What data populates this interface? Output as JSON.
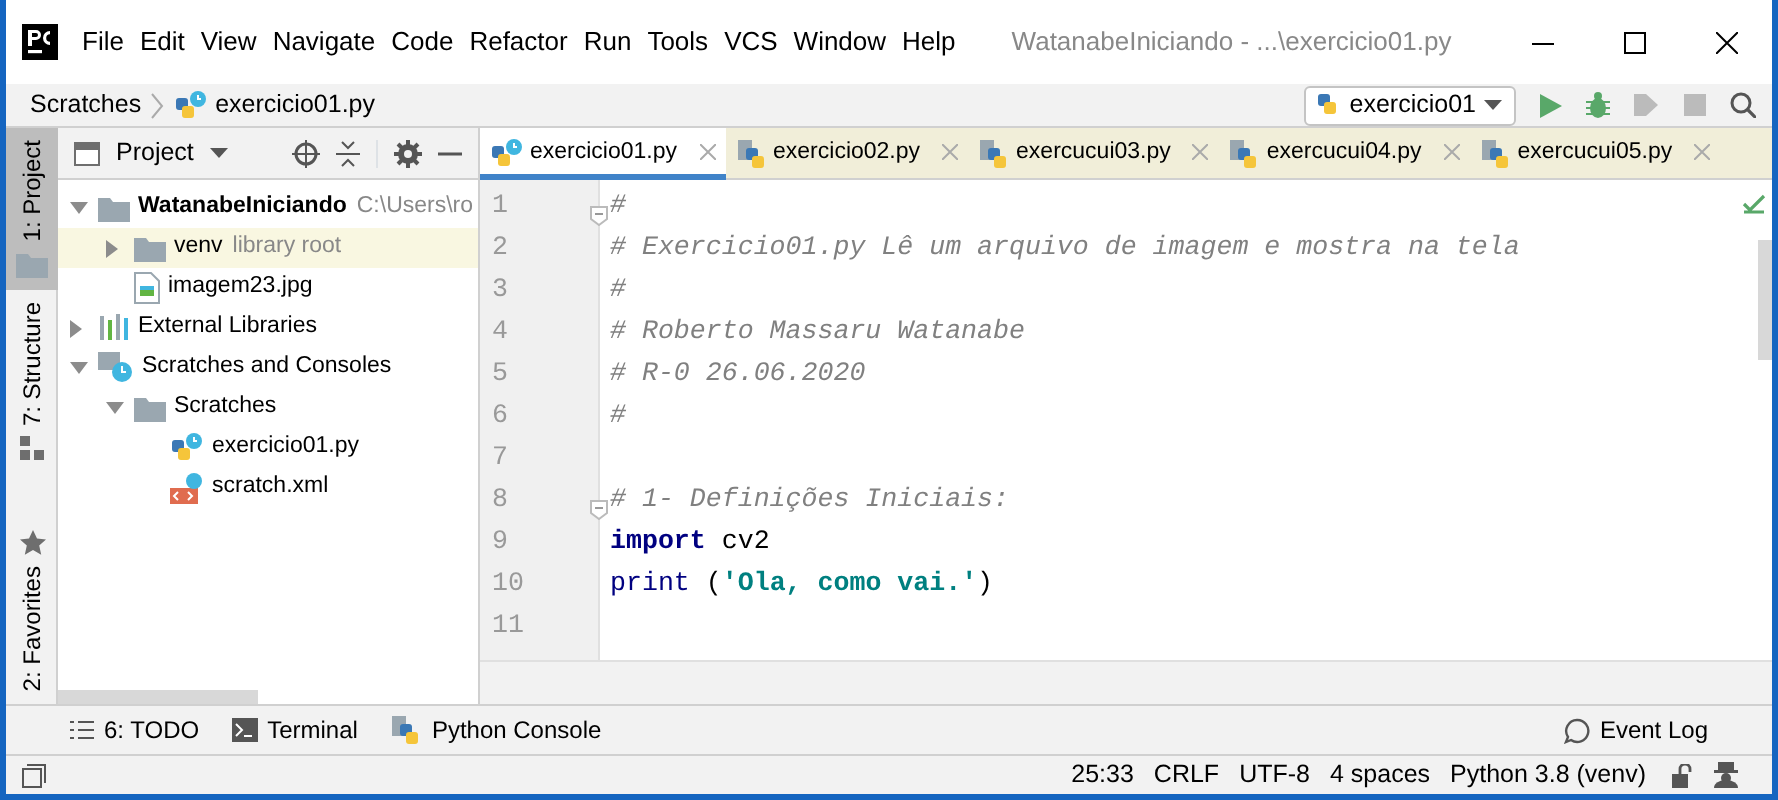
{
  "window": {
    "title": "WatanabeIniciando - ...\\exercicio01.py"
  },
  "menu": [
    "File",
    "Edit",
    "View",
    "Navigate",
    "Code",
    "Refactor",
    "Run",
    "Tools",
    "VCS",
    "Window",
    "Help"
  ],
  "breadcrumbs": [
    {
      "label": "Scratches"
    },
    {
      "label": "exercicio01.py",
      "kind": "python-scratch"
    }
  ],
  "run_configuration": {
    "label": "exercicio01"
  },
  "left_stripe": [
    {
      "label": "1: Project",
      "kind": "folder",
      "selected": true
    },
    {
      "label": "7: Structure",
      "kind": "structure",
      "selected": false
    },
    {
      "label": "2: Favorites",
      "kind": "star",
      "selected": false
    }
  ],
  "project_panel": {
    "title": "Project",
    "tree": [
      {
        "label": "WatanabeIniciando",
        "hint": "C:\\Users\\ro",
        "kind": "folder",
        "bold": true,
        "expanded": true,
        "highlighted": false,
        "children": [
          {
            "label": "venv",
            "hint": "library root",
            "kind": "folder",
            "bold": false,
            "expanded": false,
            "highlighted": true
          },
          {
            "label": "imagem23.jpg",
            "kind": "image",
            "bold": false,
            "highlighted": false
          }
        ]
      },
      {
        "label": "External Libraries",
        "kind": "libraries",
        "bold": false,
        "expanded": false,
        "highlighted": false
      },
      {
        "label": "Scratches and Consoles",
        "kind": "scratches",
        "bold": false,
        "expanded": true,
        "highlighted": false,
        "children": [
          {
            "label": "Scratches",
            "kind": "folder",
            "bold": false,
            "expanded": true,
            "highlighted": false,
            "children": [
              {
                "label": "exercicio01.py",
                "kind": "python-scratch",
                "bold": false,
                "highlighted": false
              },
              {
                "label": "scratch.xml",
                "kind": "xml-scratch",
                "bold": false,
                "highlighted": false
              }
            ]
          }
        ]
      }
    ]
  },
  "editor_tabs": [
    {
      "label": "exercicio01.py",
      "kind": "python-scratch",
      "selected": true
    },
    {
      "label": "exercicio02.py",
      "kind": "python",
      "selected": false
    },
    {
      "label": "exercucui03.py",
      "kind": "python",
      "selected": false
    },
    {
      "label": "exercucui04.py",
      "kind": "python",
      "selected": false
    },
    {
      "label": "exercucui05.py",
      "kind": "python",
      "selected": false
    }
  ],
  "code": [
    {
      "number": "1",
      "fold": true,
      "tokens": [
        {
          "kind": "comment",
          "text": "#"
        }
      ]
    },
    {
      "number": "2",
      "fold": false,
      "tokens": [
        {
          "kind": "comment",
          "text": "# Exercicio01.py Lê um arquivo de imagem e mostra na tela"
        }
      ]
    },
    {
      "number": "3",
      "fold": false,
      "tokens": [
        {
          "kind": "comment",
          "text": "#"
        }
      ]
    },
    {
      "number": "4",
      "fold": false,
      "tokens": [
        {
          "kind": "comment",
          "text": "# Roberto Massaru Watanabe"
        }
      ]
    },
    {
      "number": "5",
      "fold": false,
      "tokens": [
        {
          "kind": "comment",
          "text": "# R-0 26.06.2020"
        }
      ]
    },
    {
      "number": "6",
      "fold": false,
      "tokens": [
        {
          "kind": "comment",
          "text": "#"
        }
      ]
    },
    {
      "number": "7",
      "fold": false
    },
    {
      "number": "8",
      "fold": true,
      "tokens": [
        {
          "kind": "comment",
          "text": "# 1- Definições Iniciais:"
        }
      ]
    },
    {
      "number": "9",
      "fold": false,
      "tokens": [
        {
          "kind": "keyword",
          "text": "import"
        },
        {
          "kind": "plain",
          "text": " cv2"
        }
      ]
    },
    {
      "number": "10",
      "fold": false,
      "tokens": [
        {
          "kind": "builtin",
          "text": "print"
        },
        {
          "kind": "plain",
          "text": " ("
        },
        {
          "kind": "string",
          "text": "'Ola, como vai.'"
        },
        {
          "kind": "plain",
          "text": ")"
        }
      ]
    },
    {
      "number": "11",
      "fold": false
    }
  ],
  "tool_buttons": [
    {
      "label": "6: TODO",
      "kind": "todo"
    },
    {
      "label": "Terminal",
      "kind": "terminal"
    },
    {
      "label": "Python Console",
      "kind": "python"
    }
  ],
  "event_log": {
    "label": "Event Log"
  },
  "status_bar": [
    "25:33",
    "CRLF",
    "UTF-8",
    "4 spaces",
    "Python 3.8 (venv)"
  ]
}
